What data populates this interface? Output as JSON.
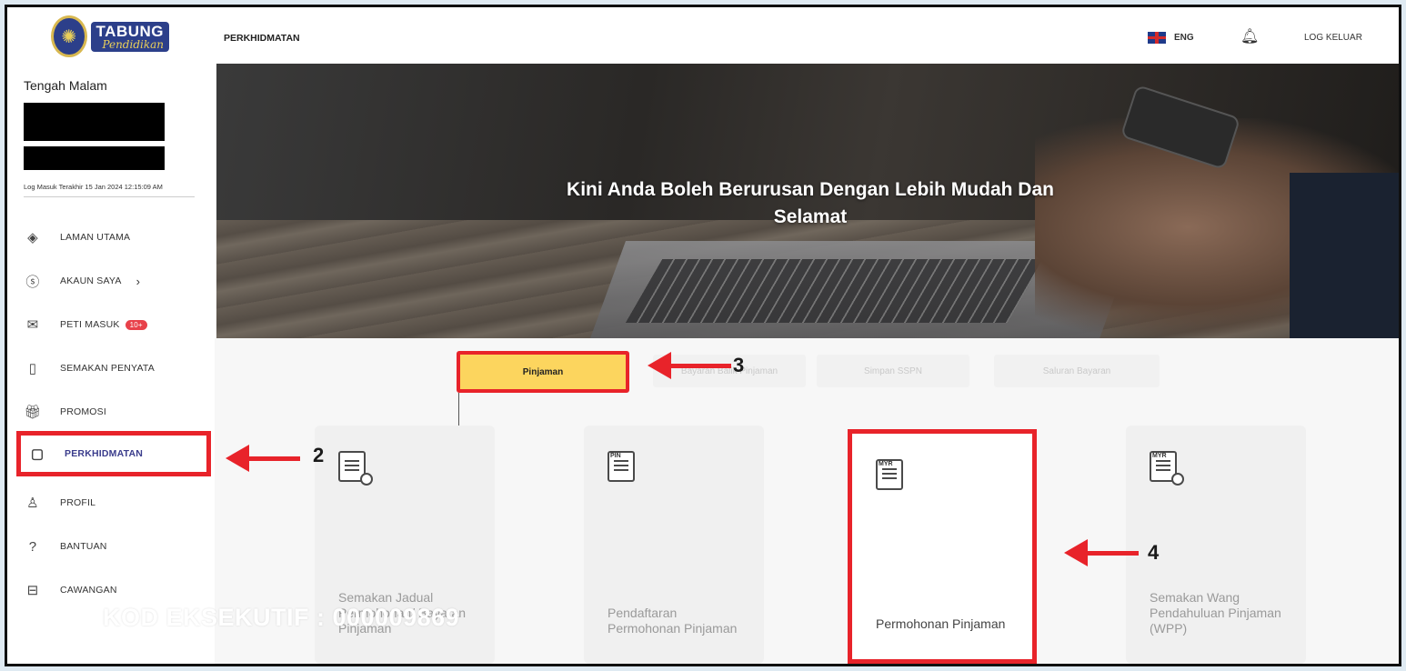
{
  "logo": {
    "line1": "TABUNG",
    "line2": "Pendidikan"
  },
  "sidebar": {
    "greeting": "Tengah Malam",
    "last_login": "Log Masuk Terakhir 15 Jan 2024 12:15:09 AM",
    "items": [
      {
        "label": "LAMAN UTAMA",
        "icon": "layers-icon"
      },
      {
        "label": "AKAUN SAYA",
        "icon": "dollar-circle-icon"
      },
      {
        "label": "PETI MASUK",
        "icon": "mail-icon",
        "badge": "10+"
      },
      {
        "label": "SEMAKAN PENYATA",
        "icon": "document-icon"
      },
      {
        "label": "PROMOSI",
        "icon": "gift-icon"
      },
      {
        "label": "PERKHIDMATAN",
        "icon": "mouse-icon",
        "active": true
      },
      {
        "label": "PROFIL",
        "icon": "user-icon"
      },
      {
        "label": "BANTUAN",
        "icon": "help-circle-icon"
      },
      {
        "label": "CAWANGAN",
        "icon": "briefcase-icon"
      }
    ]
  },
  "header": {
    "title": "PERKHIDMATAN",
    "lang": "ENG",
    "logout": "LOG KELUAR"
  },
  "hero": {
    "line1": "Kini Anda Boleh Berurusan Dengan Lebih Mudah Dan",
    "line2": "Selamat"
  },
  "tabs": [
    {
      "label": "Pinjaman",
      "active": true
    },
    {
      "label": "Bayaran Balik Pinjaman"
    },
    {
      "label": "Simpan SSPN"
    },
    {
      "label": "Saluran Bayaran"
    }
  ],
  "cards": [
    {
      "title": "Semakan Jadual Permohonan/ Bayaran Pinjaman",
      "icon": "document-search-icon"
    },
    {
      "title": "Pendaftaran Permohonan Pinjaman",
      "icon": "pin-document-icon",
      "icon_text": "PIN"
    },
    {
      "title": "Permohonan Pinjaman",
      "icon": "myr-receipt-icon",
      "icon_text": "MYR"
    },
    {
      "title": "Semakan Wang Pendahuluan Pinjaman (WPP)",
      "icon": "myr-search-icon",
      "icon_text": "MYR"
    }
  ],
  "annotations": {
    "n2": "2",
    "n3": "3",
    "n4": "4",
    "kod": "KOD EKSEKUTIF : 000009869",
    "color": "#e8232a"
  }
}
